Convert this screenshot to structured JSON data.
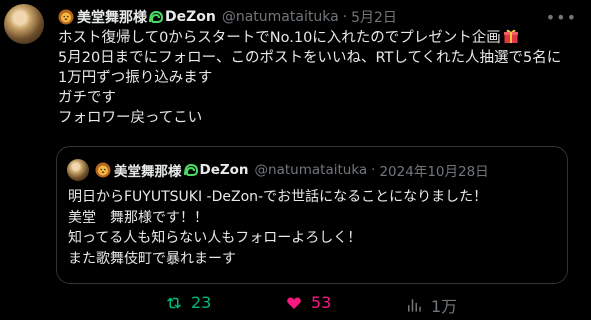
{
  "post": {
    "author_name": "美堂舞那様",
    "author_brand": "DeZon",
    "handle": "@natumataituka",
    "separator": "·",
    "date": "5月2日",
    "more_icon": "more-horizontal-icon",
    "lines": [
      "ホスト復帰して0からスタートでNo.10に入れたのでプレゼント企画",
      "5月20日までにフォロー、このポストをいいね、RTしてくれた人抽選で5名に",
      "1万円ずつ振り込みます",
      "ガチです",
      "フォロワー戻ってこい"
    ]
  },
  "quote": {
    "author_name": "美堂舞那様",
    "author_brand": "DeZon",
    "handle": "@natumataituka",
    "separator": "·",
    "date": "2024年10月28日",
    "lines": [
      "明日からFUYUTSUKI -DeZon-でお世話になることになりました！",
      "美堂　舞那様です！！",
      "知ってる人も知らない人もフォローよろしく！",
      "また歌舞伎町で暴れまーす"
    ]
  },
  "actions": {
    "retweet_count": "23",
    "like_count": "53",
    "views_count": "1万"
  },
  "colors": {
    "background": "#000000",
    "text": "#e7e9ea",
    "muted": "#71767b",
    "retweet": "#00ba7c",
    "like": "#f91880",
    "border": "#2f3336"
  }
}
